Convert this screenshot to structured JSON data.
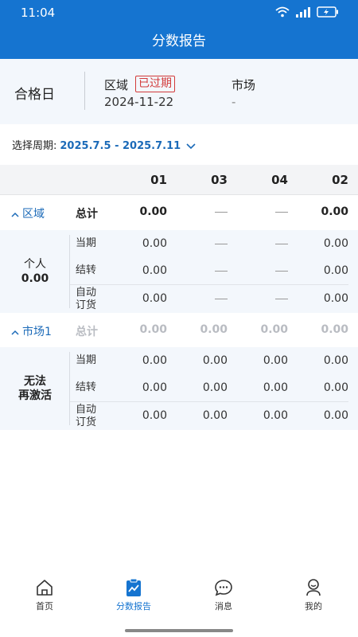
{
  "status": {
    "time": "11:04"
  },
  "app": {
    "title": "分数报告"
  },
  "info": {
    "pass_day": "合格日",
    "region_label": "区域",
    "expired_badge": "已过期",
    "region_date": "2024-11-22",
    "market_label": "市场",
    "market_value": "-"
  },
  "period": {
    "label": "选择周期:",
    "range": "2025.7.5 - 2025.7.11"
  },
  "table": {
    "columns": [
      "01",
      "03",
      "04",
      "02"
    ],
    "groups": [
      {
        "name": "区域",
        "total_label": "总计",
        "totals": [
          "0.00",
          "—",
          "—",
          "0.00"
        ],
        "side_label_1": "个人",
        "side_label_2": "0.00",
        "rows": [
          {
            "label": "当期",
            "values": [
              "0.00",
              "—",
              "—",
              "0.00"
            ]
          },
          {
            "label": "结转",
            "values": [
              "0.00",
              "—",
              "—",
              "0.00"
            ]
          },
          {
            "label_1": "自动",
            "label_2": "订货",
            "values": [
              "0.00",
              "—",
              "—",
              "0.00"
            ]
          }
        ]
      },
      {
        "name": "市场1",
        "total_label": "总计",
        "totals": [
          "0.00",
          "0.00",
          "0.00",
          "0.00"
        ],
        "side_label_1": "无法",
        "side_label_2": "再激活",
        "rows": [
          {
            "label": "当期",
            "values": [
              "0.00",
              "0.00",
              "0.00",
              "0.00"
            ]
          },
          {
            "label": "结转",
            "values": [
              "0.00",
              "0.00",
              "0.00",
              "0.00"
            ]
          },
          {
            "label_1": "自动",
            "label_2": "订货",
            "values": [
              "0.00",
              "0.00",
              "0.00",
              "0.00"
            ]
          }
        ]
      }
    ]
  },
  "tabs": [
    {
      "label": "首页",
      "icon": "home-icon"
    },
    {
      "label": "分数报告",
      "icon": "report-icon"
    },
    {
      "label": "消息",
      "icon": "message-icon"
    },
    {
      "label": "我的",
      "icon": "profile-icon"
    }
  ],
  "colors": {
    "primary": "#1574d0",
    "accent_text": "#1b6ab8",
    "expired": "#d23a3a",
    "panel_bg": "#f3f7fc"
  }
}
